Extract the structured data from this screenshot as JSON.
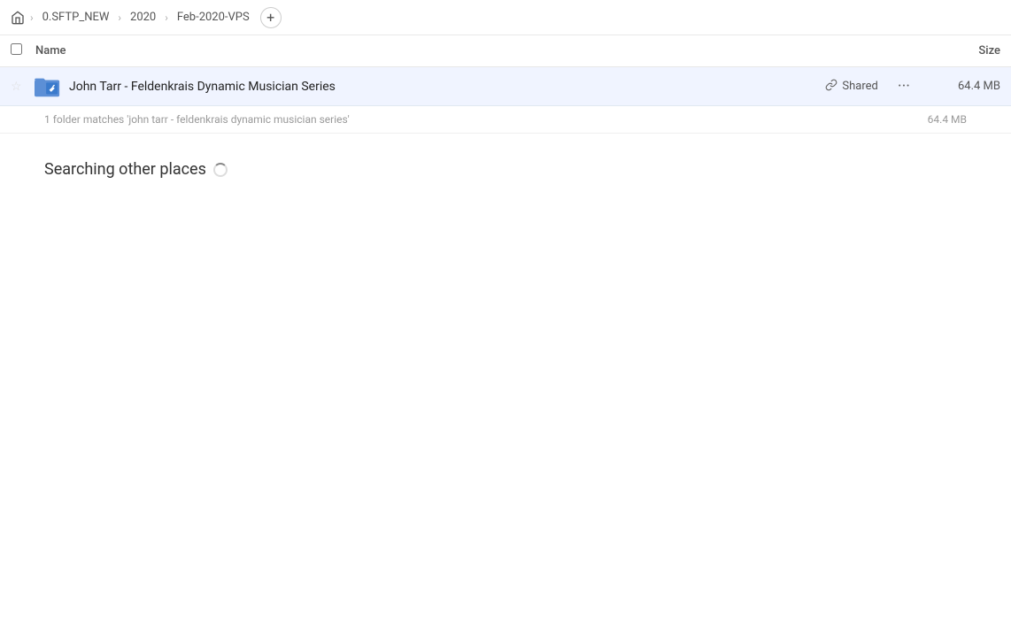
{
  "breadcrumb": {
    "home_icon": "🏠",
    "items": [
      "0.SFTP_NEW",
      "2020",
      "Feb-2020-VPS"
    ],
    "add_label": "+"
  },
  "table": {
    "header": {
      "name_label": "Name",
      "size_label": "Size"
    }
  },
  "file_row": {
    "name": "John Tarr - Feldenkrais Dynamic Musician Series",
    "shared_label": "Shared",
    "size": "64.4 MB"
  },
  "match_info": {
    "text": "1 folder matches 'john tarr - feldenkrais dynamic musician series'",
    "size": "64.4 MB"
  },
  "searching": {
    "title": "Searching other places"
  }
}
